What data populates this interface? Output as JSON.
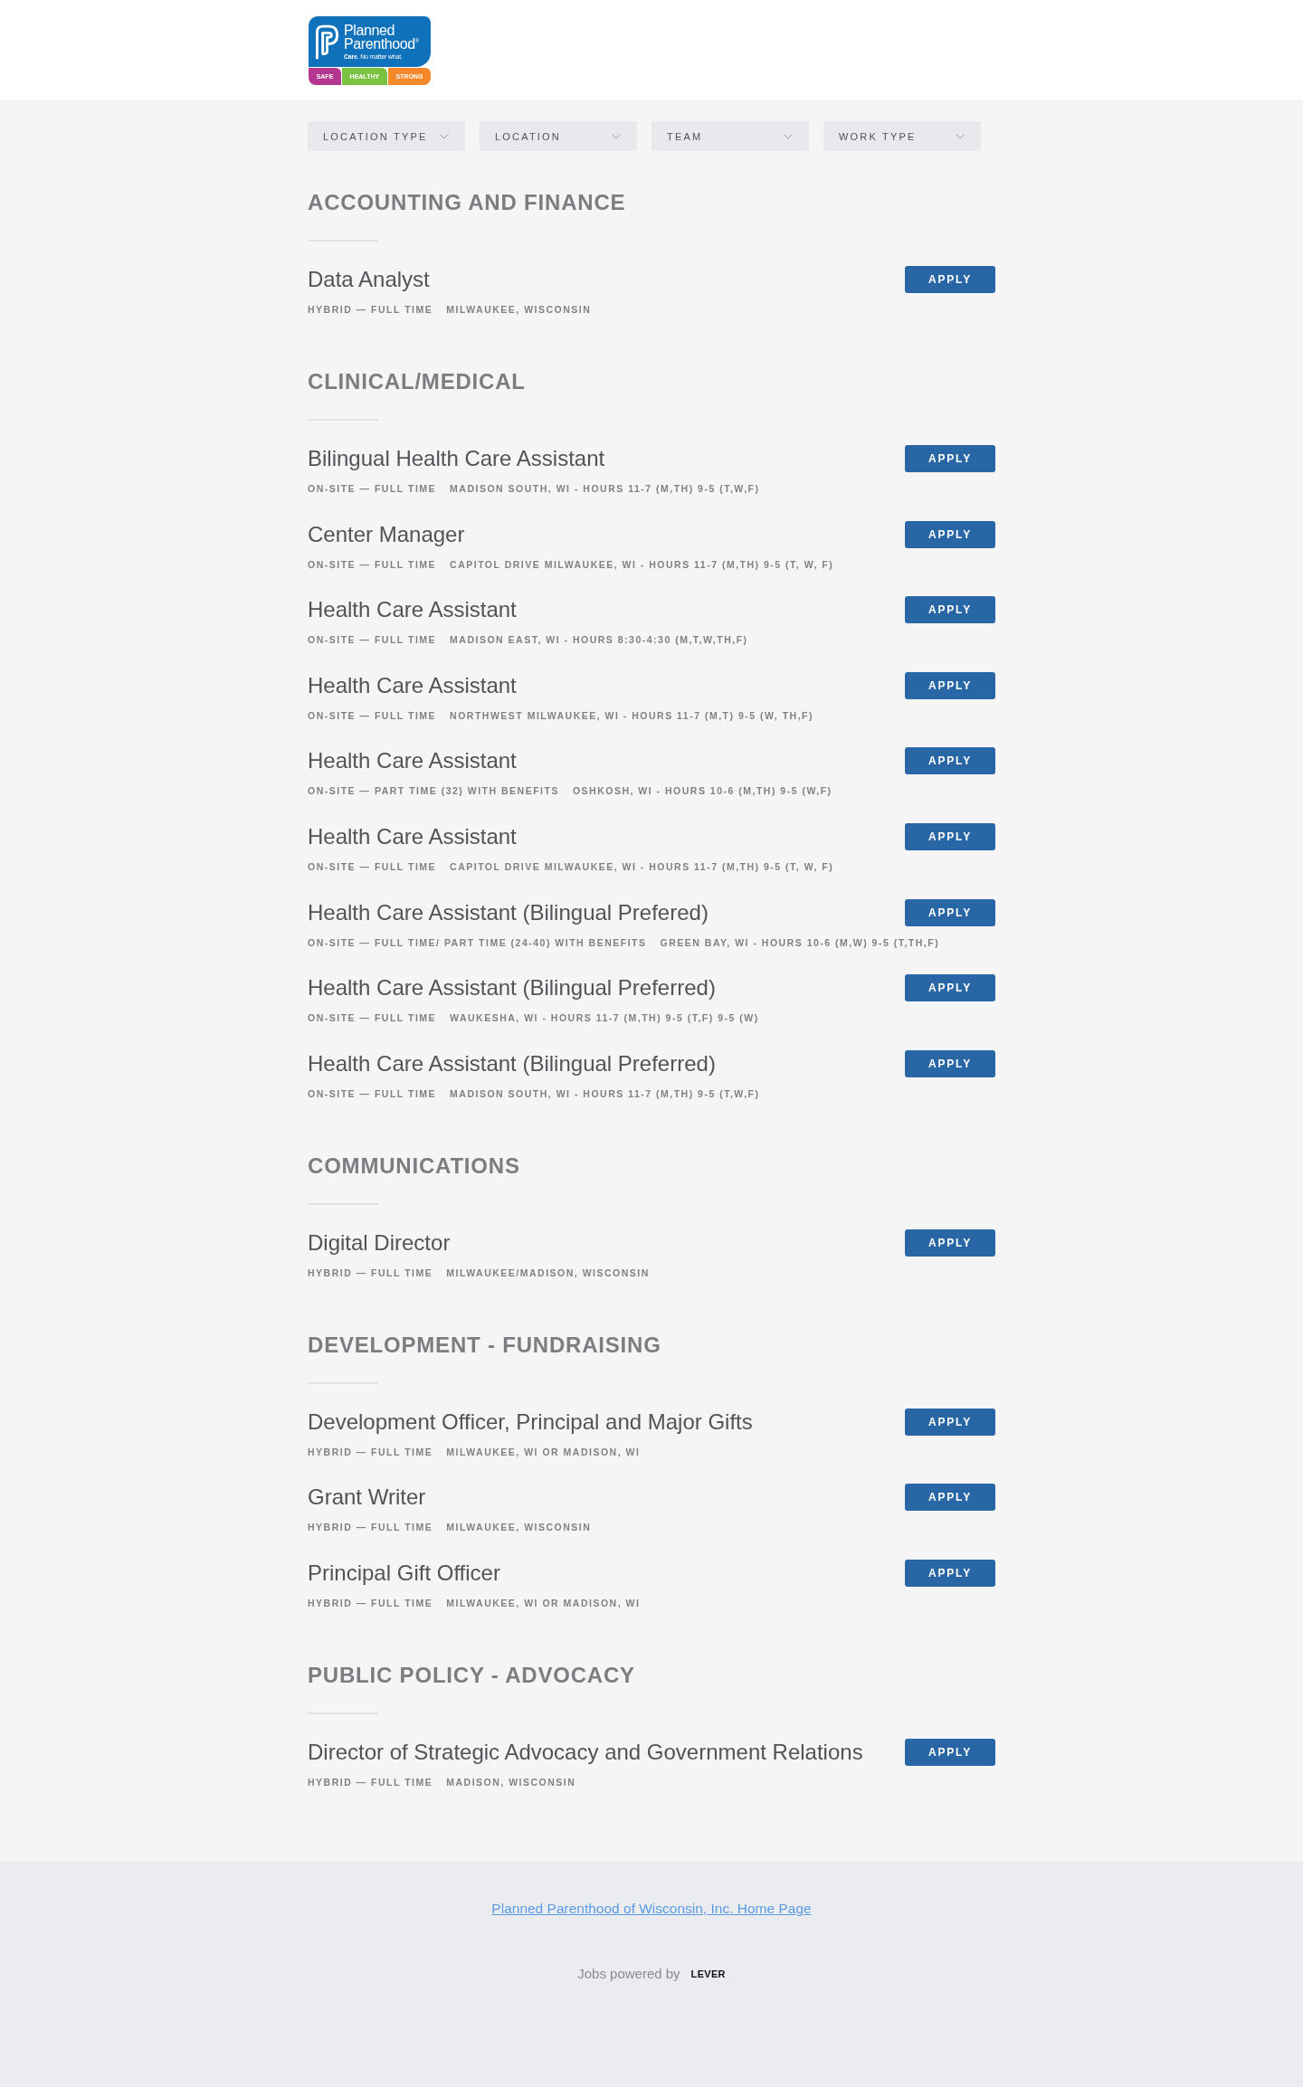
{
  "header": {
    "logo": {
      "wordmark": "Planned Parenthood$^{®}$",
      "tagline": "**Care.** No matter what.",
      "tabs": [
        {
          "label": "SAFE",
          "color": "#b3378e"
        },
        {
          "label": "HEALTHY",
          "color": "#7cc242"
        },
        {
          "label": "STRONG",
          "color": "#f5882a"
        }
      ]
    }
  },
  "filters": [
    "LOCATION TYPE",
    "LOCATION",
    "TEAM",
    "WORK TYPE"
  ],
  "sections": [
    {
      "title": "ACCOUNTING AND FINANCE",
      "postings": [
        {
          "title": "Data Analyst",
          "terms": "HYBRID — FULL TIME",
          "location": "MILWAUKEE, WISCONSIN",
          "button": "APPLY"
        }
      ]
    },
    {
      "title": "CLINICAL/MEDICAL",
      "postings": [
        {
          "title": "Bilingual Health Care Assistant",
          "terms": "ON-SITE — FULL TIME",
          "location": "MADISON SOUTH, WI - HOURS 11-7 (M,TH) 9-5 (T,W,F)",
          "button": "APPLY"
        },
        {
          "title": "Center Manager",
          "terms": "ON-SITE — FULL TIME",
          "location": "CAPITOL DRIVE MILWAUKEE, WI - HOURS 11-7 (M,TH) 9-5 (T, W, F)",
          "button": "APPLY"
        },
        {
          "title": "Health Care Assistant",
          "terms": "ON-SITE — FULL TIME",
          "location": "MADISON EAST, WI - HOURS 8:30-4:30 (M,T,W,TH,F)",
          "button": "APPLY"
        },
        {
          "title": "Health Care Assistant",
          "terms": "ON-SITE — FULL TIME",
          "location": "NORTHWEST MILWAUKEE, WI - HOURS 11-7 (M,T) 9-5 (W, TH,F)",
          "button": "APPLY"
        },
        {
          "title": "Health Care Assistant",
          "terms": "ON-SITE — PART TIME (32) WITH BENEFITS",
          "location": "OSHKOSH, WI - HOURS 10-6 (M,TH) 9-5 (W,F)",
          "button": "APPLY"
        },
        {
          "title": "Health Care Assistant",
          "terms": "ON-SITE — FULL TIME",
          "location": "CAPITOL DRIVE MILWAUKEE, WI - HOURS 11-7 (M,TH) 9-5 (T, W, F)",
          "button": "APPLY"
        },
        {
          "title": "Health Care Assistant (Bilingual Prefered)",
          "terms": "ON-SITE — FULL TIME/ PART TIME (24-40) WITH BENEFITS",
          "location": "GREEN BAY, WI - HOURS 10-6 (M,W) 9-5 (T,TH,F)",
          "button": "APPLY"
        },
        {
          "title": "Health Care Assistant (Bilingual Preferred)",
          "terms": "ON-SITE — FULL TIME",
          "location": "WAUKESHA, WI - HOURS 11-7 (M,TH) 9-5 (T,F) 9-5 (W)",
          "button": "APPLY"
        },
        {
          "title": "Health Care Assistant (Bilingual Preferred)",
          "terms": "ON-SITE — FULL TIME",
          "location": "MADISON SOUTH, WI - HOURS 11-7 (M,TH) 9-5 (T,W,F)",
          "button": "APPLY"
        }
      ]
    },
    {
      "title": "COMMUNICATIONS",
      "postings": [
        {
          "title": "Digital Director",
          "terms": "HYBRID — FULL TIME",
          "location": "MILWAUKEE/MADISON, WISCONSIN",
          "button": "APPLY"
        }
      ]
    },
    {
      "title": "DEVELOPMENT - FUNDRAISING",
      "postings": [
        {
          "title": "Development Officer, Principal and Major Gifts",
          "terms": "HYBRID — FULL TIME",
          "location": "MILWAUKEE, WI OR MADISON, WI",
          "button": "APPLY"
        },
        {
          "title": "Grant Writer",
          "terms": "HYBRID — FULL TIME",
          "location": "MILWAUKEE, WISCONSIN",
          "button": "APPLY"
        },
        {
          "title": "Principal Gift Officer",
          "terms": "HYBRID — FULL TIME",
          "location": "MILWAUKEE, WI OR MADISON, WI",
          "button": "APPLY"
        }
      ]
    },
    {
      "title": "PUBLIC POLICY - ADVOCACY",
      "postings": [
        {
          "title": "Director of Strategic Advocacy and Government Relations",
          "terms": "HYBRID — FULL TIME",
          "location": "MADISON, WISCONSIN",
          "button": "APPLY"
        }
      ]
    }
  ],
  "footer": {
    "home_link": "Planned Parenthood of Wisconsin, Inc. Home Page",
    "powered_by": "Jobs powered by",
    "lever_logo": "LEVER"
  }
}
